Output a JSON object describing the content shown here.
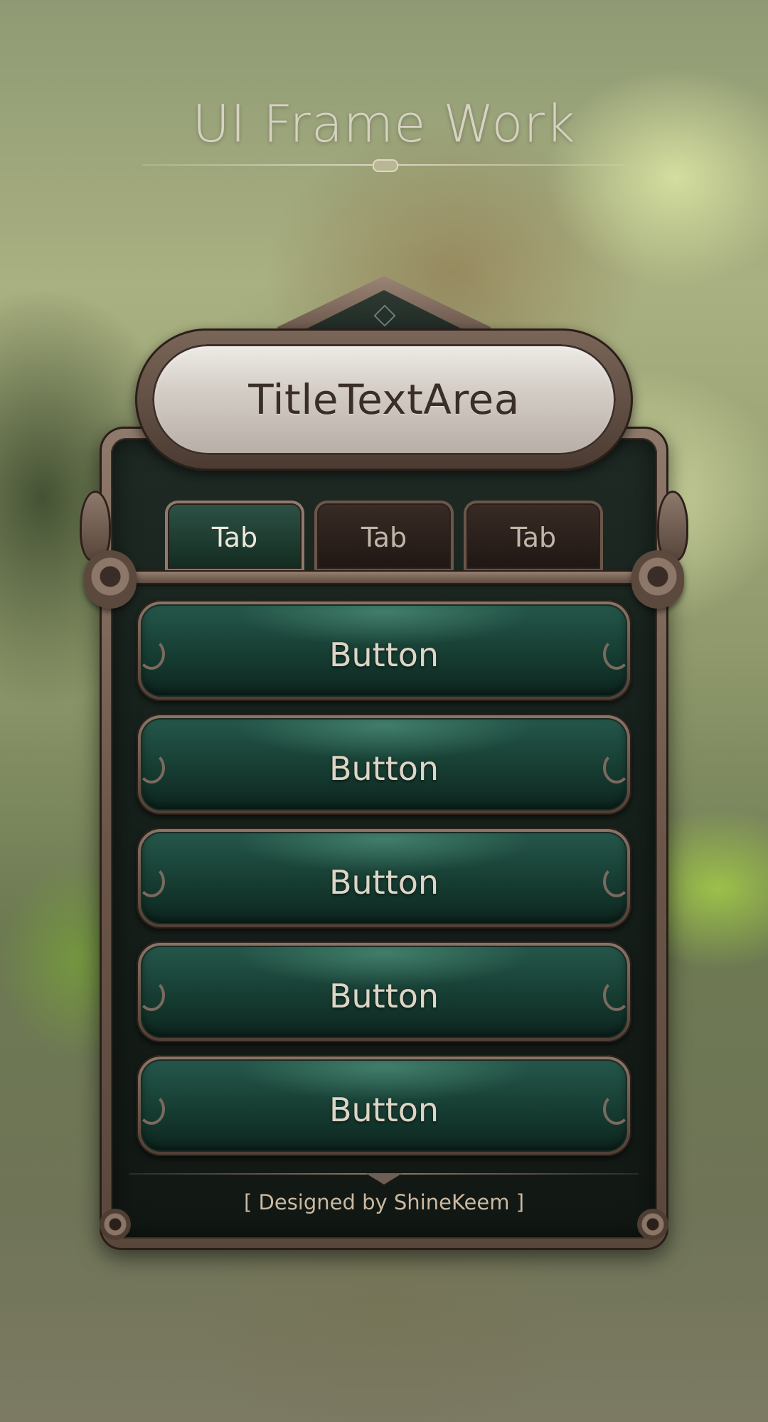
{
  "header": {
    "title": "UI Frame Work"
  },
  "panel": {
    "title": "TitleTextArea",
    "tabs": [
      {
        "label": "Tab",
        "active": true
      },
      {
        "label": "Tab",
        "active": false
      },
      {
        "label": "Tab",
        "active": false
      }
    ],
    "buttons": [
      {
        "label": "Button"
      },
      {
        "label": "Button"
      },
      {
        "label": "Button"
      },
      {
        "label": "Button"
      },
      {
        "label": "Button"
      }
    ],
    "footer": "[ Designed by ShineKeem ]"
  },
  "colors": {
    "frame": "#6b5649",
    "panel_bg": "#17211c",
    "button_green": "#1f4d40",
    "title_plate": "#d2cbc4",
    "footer_text": "#cbb9a1"
  },
  "icons": [
    "title-divider-ornament",
    "crown-gem-icon",
    "scroll-ornament-icon",
    "leaf-ornament-icon",
    "swirl-icon",
    "chevron-divider-icon"
  ]
}
